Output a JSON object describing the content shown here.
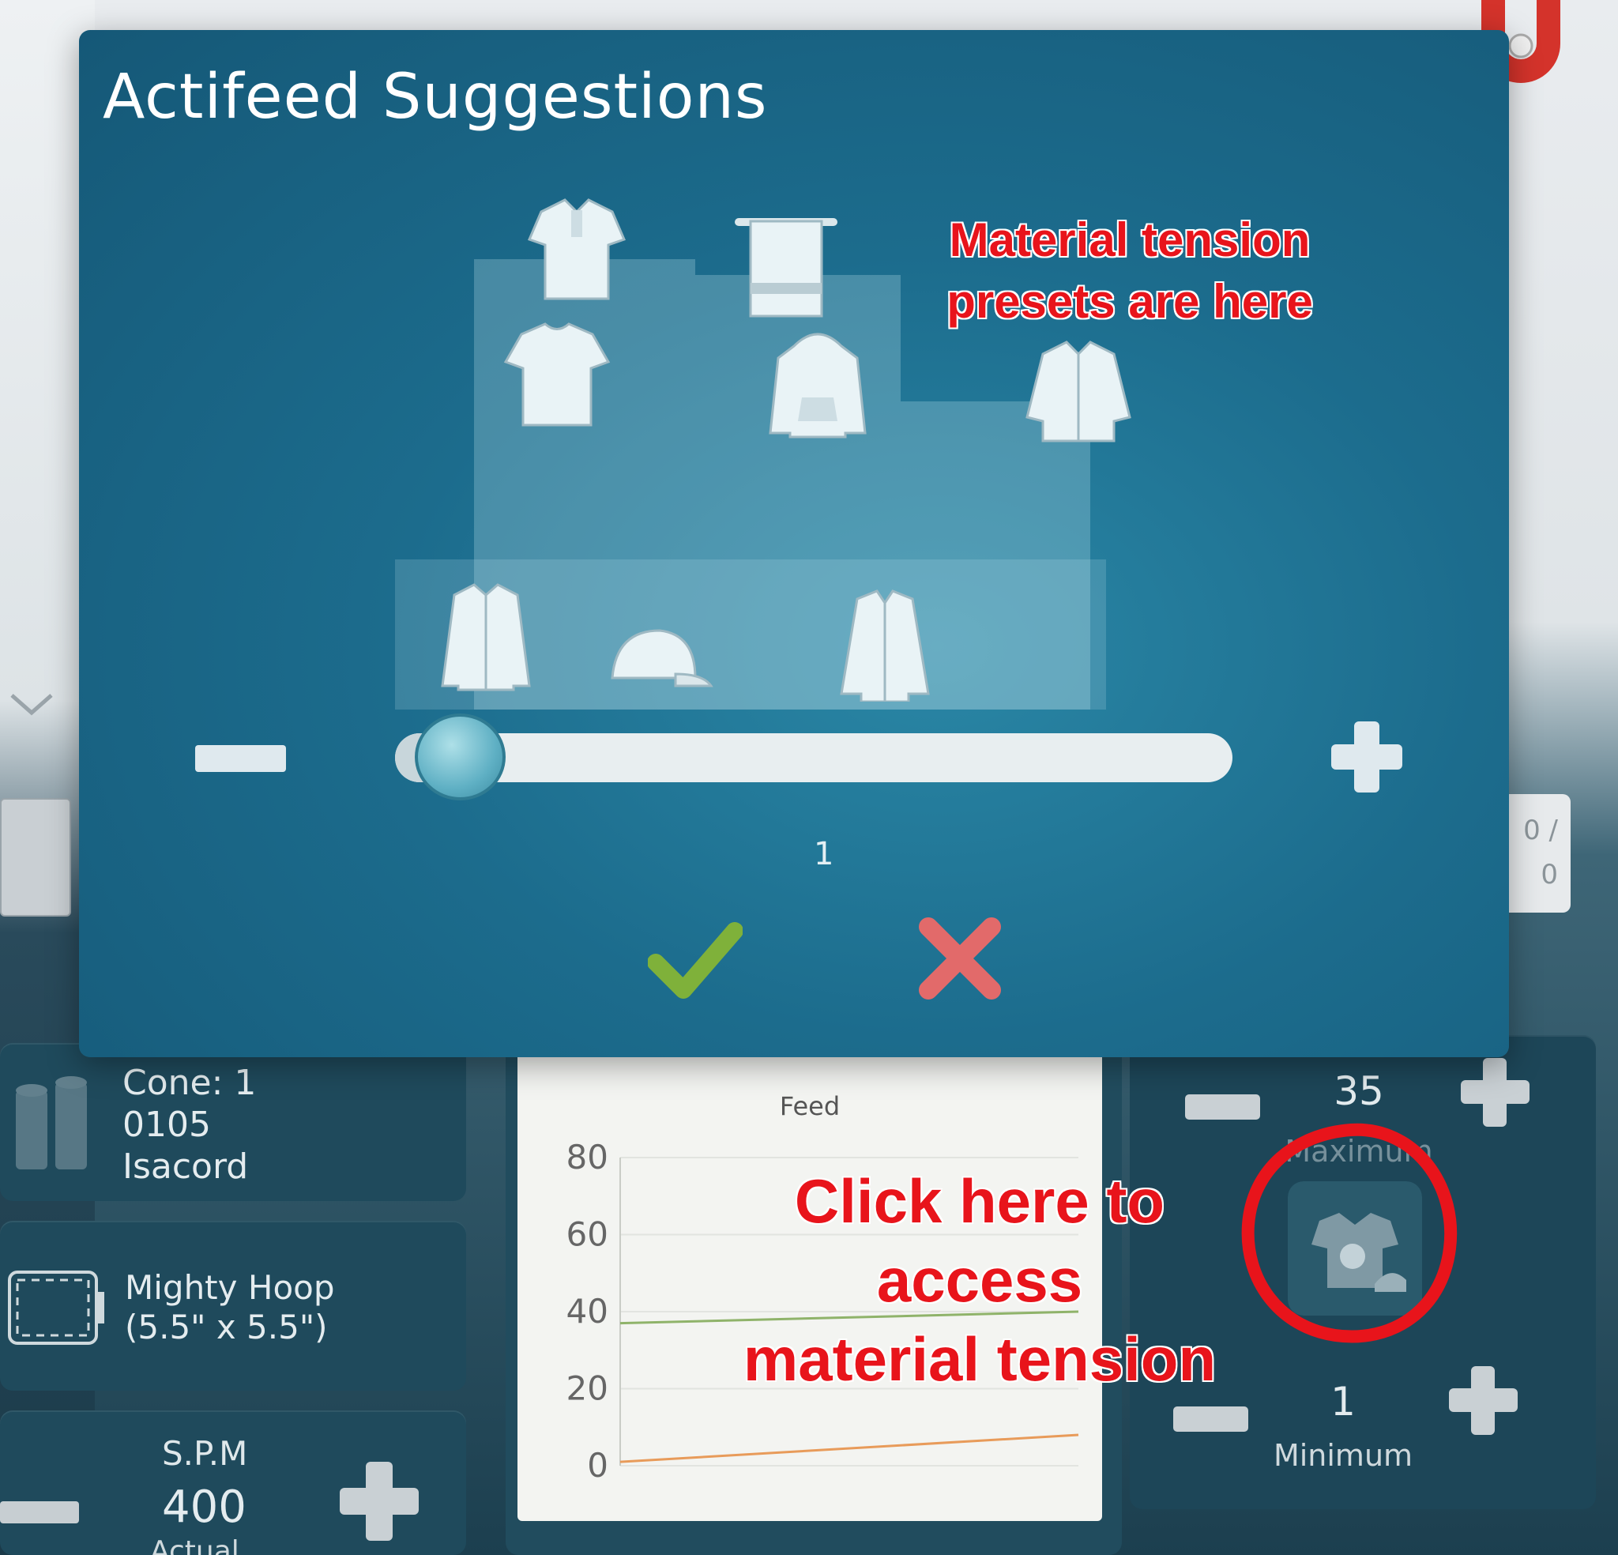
{
  "dialog": {
    "title": "Actifeed Suggestions",
    "slider": {
      "value_label": "1",
      "position_fraction": 0.05
    },
    "presets": [
      "polo-shirt",
      "towel",
      "t-shirt",
      "hoodie",
      "jacket",
      "dress-shirt",
      "cap",
      "zip-jacket"
    ]
  },
  "annotations": {
    "presets_line1": "Material tension",
    "presets_line2": "presets are here",
    "access_line1": "Click here to",
    "access_line2": "access",
    "access_line3": "material tension"
  },
  "thread": {
    "line1": "Cone: 1",
    "line2": "0105",
    "line3": "Isacord"
  },
  "hoop": {
    "line1": "Mighty Hoop",
    "line2": "(5.5\" x 5.5\")"
  },
  "spm": {
    "label": "S.P.M",
    "value": "400",
    "sub": "Actual"
  },
  "counter": {
    "top": "0 /",
    "bottom": "0"
  },
  "tension": {
    "max_value": "35",
    "max_label": "Maximum",
    "min_value": "1",
    "min_label": "Minimum"
  },
  "chart_data": {
    "type": "line",
    "title": "Feed",
    "y_ticks": [
      "80",
      "60",
      "40",
      "20",
      "0"
    ],
    "ylim": [
      0,
      80
    ],
    "series": [
      {
        "color": "#8fb36a",
        "values": [
          37,
          40
        ]
      },
      {
        "color": "#e89b5a",
        "values": [
          1,
          8
        ]
      }
    ]
  },
  "colors": {
    "dialog_bg": "#1c6c8d",
    "annotation_red": "#e8141b",
    "confirm_green": "#7fb13a",
    "cancel_red": "#e26a6a"
  }
}
